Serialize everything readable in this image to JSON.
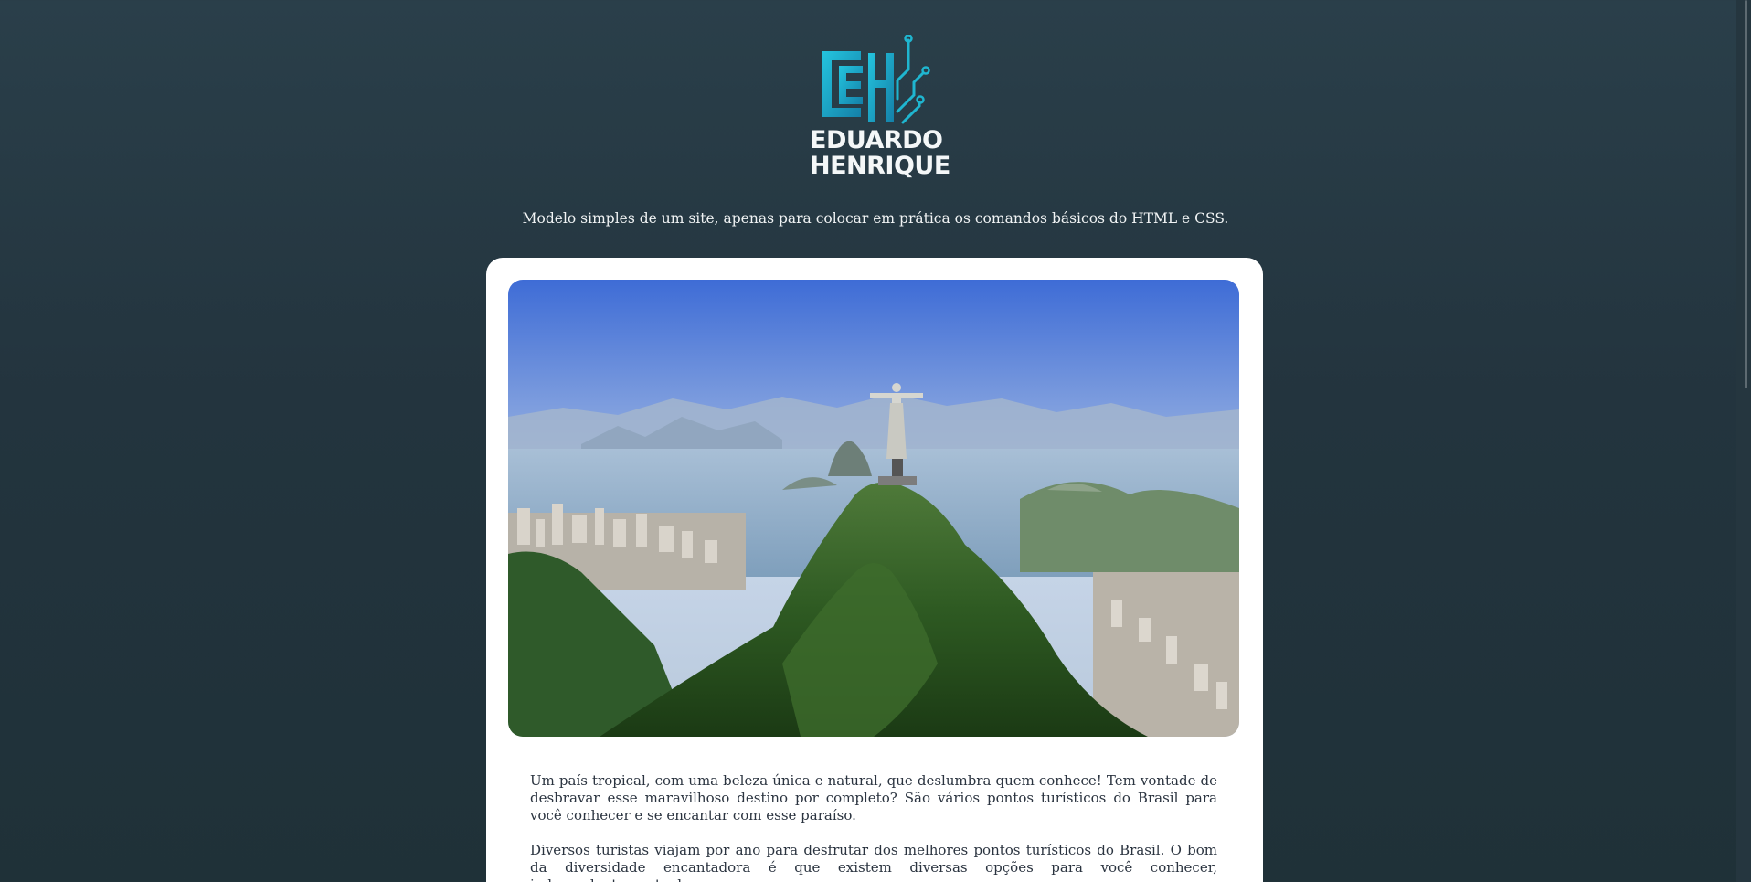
{
  "header": {
    "logo": {
      "monogram": "EH",
      "name_line1": "EDUARDO",
      "name_line2": "HENRIQUE",
      "icon": "circuit-monogram-logo",
      "accent_color": "#1fb6d0"
    },
    "tagline": "Modelo simples de um site, apenas para colocar em prática os comandos básicos do HTML e CSS."
  },
  "main": {
    "image": {
      "icon": "christ-the-redeemer-photo"
    },
    "paragraphs": [
      "Um país tropical, com uma beleza única e natural, que deslumbra quem conhece! Tem vontade de desbravar esse maravilhoso destino por completo? São vários pontos turísticos do Brasil para você conhecer e se encantar com esse paraíso.",
      "Diversos turistas viajam por ano para desfrutar dos melhores pontos turísticos do Brasil. O bom da diversidade encantadora é que existem diversas opções para você conhecer, independentemente de"
    ]
  },
  "colors": {
    "background_top": "#2a3f4a",
    "background_bottom": "#1f3138",
    "card": "#ffffff",
    "text": "#2b3440"
  }
}
